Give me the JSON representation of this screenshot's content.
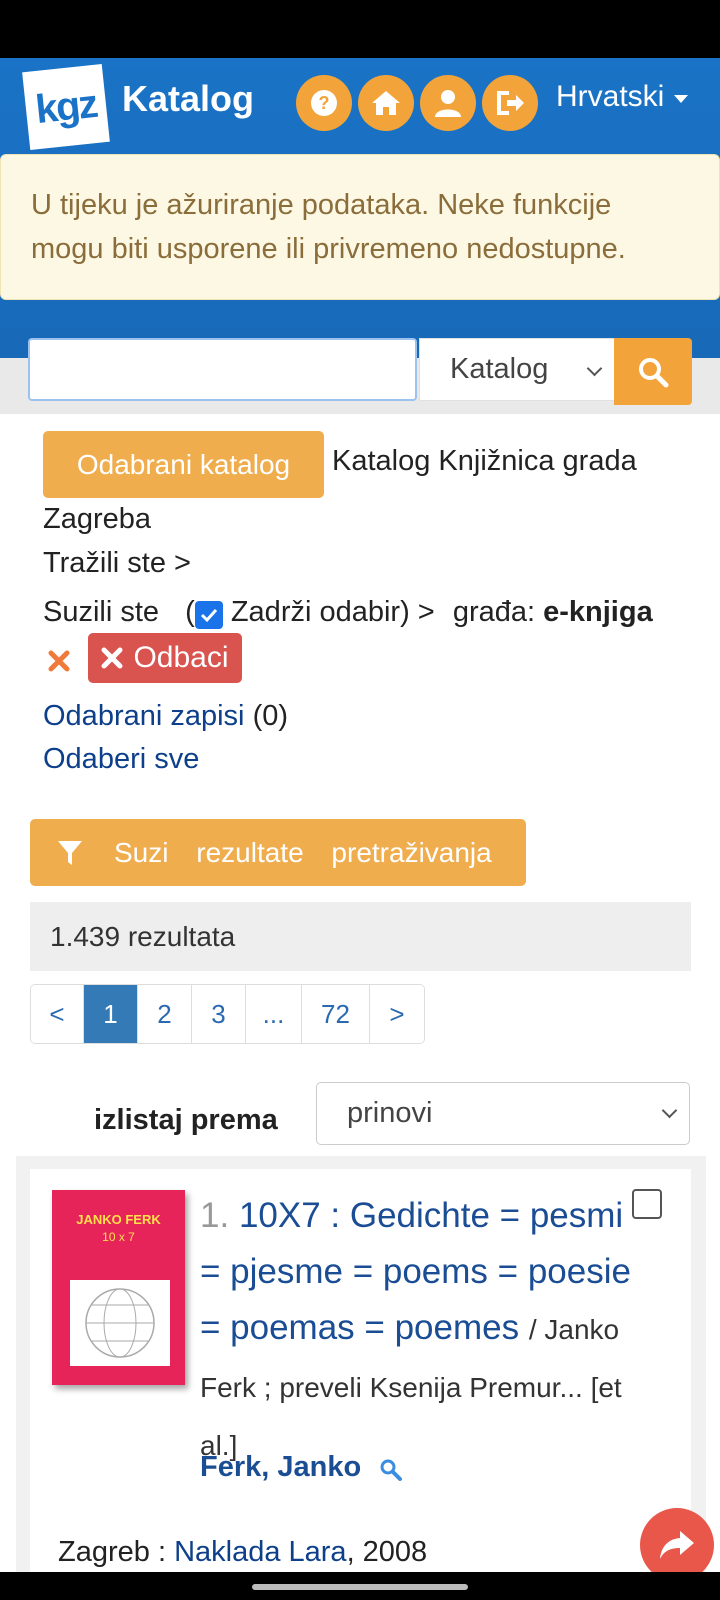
{
  "header": {
    "logo_text": "kgz",
    "title": "Katalog",
    "icons": [
      "help-icon",
      "home-icon",
      "user-icon",
      "logout-icon"
    ],
    "language": "Hrvatski",
    "accent_color": "#f2a43a",
    "brand_color": "#1a73c6"
  },
  "notice": {
    "text": "U tijeku je ažuriranje podataka. Neke funkcije mogu biti usporene ili privremeno nedostupne."
  },
  "search": {
    "value": "",
    "catalog_option": "Katalog"
  },
  "context": {
    "selected_catalog_button": "Odabrani katalog",
    "catalog_name_line1": "Katalog Knjižnica grada",
    "catalog_name_line2": "Zagreba",
    "searched": "Tražili ste >",
    "narrowed": "Suzili ste",
    "keep_selection": "Zadrži odabir) >",
    "keep_selection_open": "(",
    "keep_checked": true,
    "filter_label": "građa:",
    "filter_value": "e-knjiga",
    "discard": "Odbaci",
    "selected_records": "Odabrani zapisi",
    "selected_count": "(0)",
    "select_all": "Odaberi sve"
  },
  "refine": {
    "label": "Suzi rezultate pretraživanja"
  },
  "results": {
    "count_text": "1.439 rezultata"
  },
  "pagination": {
    "prev": "<",
    "pages": [
      "1",
      "2",
      "3",
      "...",
      "72"
    ],
    "next": ">",
    "current": "1"
  },
  "sort": {
    "label": "izlistaj prema",
    "value": "prinovi"
  },
  "records": [
    {
      "index": "1.",
      "title": "10X7 : Gedichte = pesmi = pjesme = poems = poesie = poemas = poemes",
      "responsibility": "/ Janko Ferk ; preveli Ksenija Premur... [et al.]",
      "author": "Ferk, Janko",
      "place": "Zagreb :",
      "publisher": "Naklada Lara",
      "year": ", 2008",
      "cover_title": "JANKO FERK",
      "cover_subtitle": "10 x 7"
    }
  ]
}
